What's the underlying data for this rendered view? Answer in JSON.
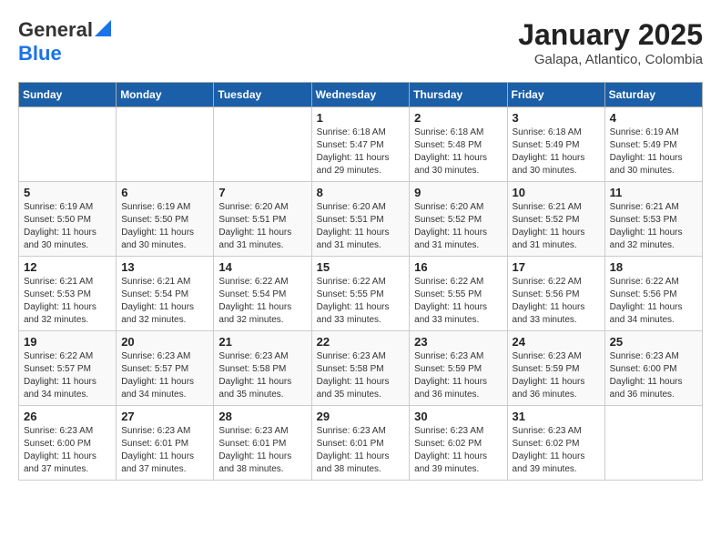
{
  "header": {
    "logo_general": "General",
    "logo_blue": "Blue",
    "month_title": "January 2025",
    "location": "Galapa, Atlantico, Colombia"
  },
  "days_of_week": [
    "Sunday",
    "Monday",
    "Tuesday",
    "Wednesday",
    "Thursday",
    "Friday",
    "Saturday"
  ],
  "weeks": [
    [
      {
        "day": "",
        "info": ""
      },
      {
        "day": "",
        "info": ""
      },
      {
        "day": "",
        "info": ""
      },
      {
        "day": "1",
        "info": "Sunrise: 6:18 AM\nSunset: 5:47 PM\nDaylight: 11 hours\nand 29 minutes."
      },
      {
        "day": "2",
        "info": "Sunrise: 6:18 AM\nSunset: 5:48 PM\nDaylight: 11 hours\nand 30 minutes."
      },
      {
        "day": "3",
        "info": "Sunrise: 6:18 AM\nSunset: 5:49 PM\nDaylight: 11 hours\nand 30 minutes."
      },
      {
        "day": "4",
        "info": "Sunrise: 6:19 AM\nSunset: 5:49 PM\nDaylight: 11 hours\nand 30 minutes."
      }
    ],
    [
      {
        "day": "5",
        "info": "Sunrise: 6:19 AM\nSunset: 5:50 PM\nDaylight: 11 hours\nand 30 minutes."
      },
      {
        "day": "6",
        "info": "Sunrise: 6:19 AM\nSunset: 5:50 PM\nDaylight: 11 hours\nand 30 minutes."
      },
      {
        "day": "7",
        "info": "Sunrise: 6:20 AM\nSunset: 5:51 PM\nDaylight: 11 hours\nand 31 minutes."
      },
      {
        "day": "8",
        "info": "Sunrise: 6:20 AM\nSunset: 5:51 PM\nDaylight: 11 hours\nand 31 minutes."
      },
      {
        "day": "9",
        "info": "Sunrise: 6:20 AM\nSunset: 5:52 PM\nDaylight: 11 hours\nand 31 minutes."
      },
      {
        "day": "10",
        "info": "Sunrise: 6:21 AM\nSunset: 5:52 PM\nDaylight: 11 hours\nand 31 minutes."
      },
      {
        "day": "11",
        "info": "Sunrise: 6:21 AM\nSunset: 5:53 PM\nDaylight: 11 hours\nand 32 minutes."
      }
    ],
    [
      {
        "day": "12",
        "info": "Sunrise: 6:21 AM\nSunset: 5:53 PM\nDaylight: 11 hours\nand 32 minutes."
      },
      {
        "day": "13",
        "info": "Sunrise: 6:21 AM\nSunset: 5:54 PM\nDaylight: 11 hours\nand 32 minutes."
      },
      {
        "day": "14",
        "info": "Sunrise: 6:22 AM\nSunset: 5:54 PM\nDaylight: 11 hours\nand 32 minutes."
      },
      {
        "day": "15",
        "info": "Sunrise: 6:22 AM\nSunset: 5:55 PM\nDaylight: 11 hours\nand 33 minutes."
      },
      {
        "day": "16",
        "info": "Sunrise: 6:22 AM\nSunset: 5:55 PM\nDaylight: 11 hours\nand 33 minutes."
      },
      {
        "day": "17",
        "info": "Sunrise: 6:22 AM\nSunset: 5:56 PM\nDaylight: 11 hours\nand 33 minutes."
      },
      {
        "day": "18",
        "info": "Sunrise: 6:22 AM\nSunset: 5:56 PM\nDaylight: 11 hours\nand 34 minutes."
      }
    ],
    [
      {
        "day": "19",
        "info": "Sunrise: 6:22 AM\nSunset: 5:57 PM\nDaylight: 11 hours\nand 34 minutes."
      },
      {
        "day": "20",
        "info": "Sunrise: 6:23 AM\nSunset: 5:57 PM\nDaylight: 11 hours\nand 34 minutes."
      },
      {
        "day": "21",
        "info": "Sunrise: 6:23 AM\nSunset: 5:58 PM\nDaylight: 11 hours\nand 35 minutes."
      },
      {
        "day": "22",
        "info": "Sunrise: 6:23 AM\nSunset: 5:58 PM\nDaylight: 11 hours\nand 35 minutes."
      },
      {
        "day": "23",
        "info": "Sunrise: 6:23 AM\nSunset: 5:59 PM\nDaylight: 11 hours\nand 36 minutes."
      },
      {
        "day": "24",
        "info": "Sunrise: 6:23 AM\nSunset: 5:59 PM\nDaylight: 11 hours\nand 36 minutes."
      },
      {
        "day": "25",
        "info": "Sunrise: 6:23 AM\nSunset: 6:00 PM\nDaylight: 11 hours\nand 36 minutes."
      }
    ],
    [
      {
        "day": "26",
        "info": "Sunrise: 6:23 AM\nSunset: 6:00 PM\nDaylight: 11 hours\nand 37 minutes."
      },
      {
        "day": "27",
        "info": "Sunrise: 6:23 AM\nSunset: 6:01 PM\nDaylight: 11 hours\nand 37 minutes."
      },
      {
        "day": "28",
        "info": "Sunrise: 6:23 AM\nSunset: 6:01 PM\nDaylight: 11 hours\nand 38 minutes."
      },
      {
        "day": "29",
        "info": "Sunrise: 6:23 AM\nSunset: 6:01 PM\nDaylight: 11 hours\nand 38 minutes."
      },
      {
        "day": "30",
        "info": "Sunrise: 6:23 AM\nSunset: 6:02 PM\nDaylight: 11 hours\nand 39 minutes."
      },
      {
        "day": "31",
        "info": "Sunrise: 6:23 AM\nSunset: 6:02 PM\nDaylight: 11 hours\nand 39 minutes."
      },
      {
        "day": "",
        "info": ""
      }
    ]
  ]
}
